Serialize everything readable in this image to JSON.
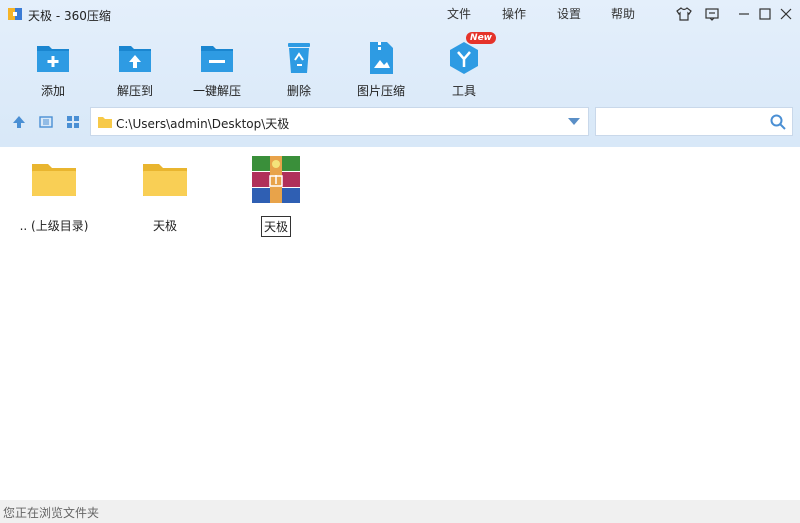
{
  "window": {
    "title": "天极 - 360压缩"
  },
  "menu": {
    "file": "文件",
    "ops": "操作",
    "settings": "设置",
    "help": "帮助"
  },
  "toolbar": {
    "add": "添加",
    "extract_to": "解压到",
    "one_click_extract": "一键解压",
    "delete": "删除",
    "image_compress": "图片压缩",
    "tools": "工具",
    "new_badge": "New"
  },
  "address": {
    "path": "C:\\Users\\admin\\Desktop\\天极"
  },
  "search": {
    "placeholder": "",
    "value": ""
  },
  "files": [
    {
      "name": ".. (上级目录)",
      "type": "folder"
    },
    {
      "name": "天极",
      "type": "folder"
    },
    {
      "name": "天极",
      "type": "archive"
    }
  ],
  "status": {
    "text": "您正在浏览文件夹"
  },
  "colors": {
    "accent": "#2e8fd6",
    "toolbar_bg": "#dde9f8",
    "folder": "#f7c948"
  }
}
